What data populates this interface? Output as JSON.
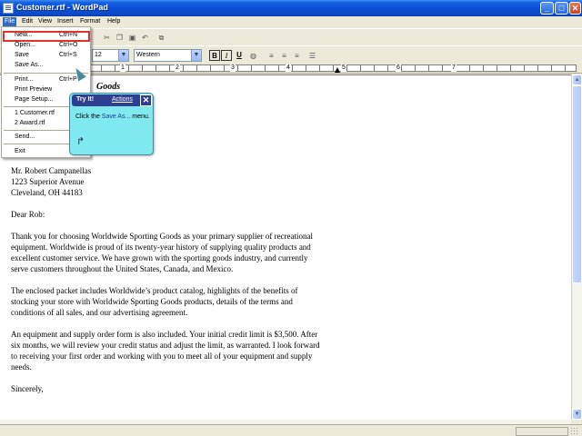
{
  "window": {
    "title": "Customer.rtf - WordPad",
    "controls": {
      "minimize": "_",
      "maximize": "□",
      "close": "✕"
    }
  },
  "menubar": {
    "file": "File",
    "edit": "Edit",
    "view": "View",
    "insert": "Insert",
    "format": "Format",
    "help": "Help"
  },
  "toolbar": {
    "font_size": "12",
    "script": "Western",
    "bold": "B",
    "italic": "I",
    "underline": "U"
  },
  "ruler": {
    "numbers": [
      "1",
      "2",
      "3",
      "4",
      "5",
      "6",
      "7"
    ]
  },
  "file_menu": {
    "items": [
      {
        "label": "New...",
        "shortcut": "Ctrl+N"
      },
      {
        "label": "Open...",
        "shortcut": "Ctrl+O"
      },
      {
        "label": "Save",
        "shortcut": "Ctrl+S"
      },
      {
        "label": "Save As...",
        "shortcut": ""
      },
      {
        "label": "Print...",
        "shortcut": "Ctrl+P"
      },
      {
        "label": "Print Preview",
        "shortcut": ""
      },
      {
        "label": "Page Setup...",
        "shortcut": ""
      },
      {
        "label": "1 Customer.rtf",
        "shortcut": ""
      },
      {
        "label": "2 Award.rtf",
        "shortcut": ""
      },
      {
        "label": "Send...",
        "shortcut": ""
      },
      {
        "label": "Exit",
        "shortcut": ""
      }
    ],
    "highlighted": "Save As..."
  },
  "tryit": {
    "title": "Try It!",
    "actions": "Actions",
    "close": "✕",
    "body_prefix": "Click the ",
    "body_highlight": "Save As...",
    "body_suffix": " menu."
  },
  "document": {
    "heading_fragment": "Goods",
    "lines": [
      "Mr. Robert Campanellas",
      "1223 Superior Avenue",
      "Cleveland, OH  44183",
      "",
      "Dear Rob:",
      "",
      "Thank you for choosing Worldwide Sporting Goods as your primary supplier of recreational",
      "equipment. Worldwide is proud of its twenty-year history of supplying quality products and",
      "excellent customer service. We have grown with the sporting goods industry, and currently",
      "serve customers throughout the United States, Canada, and Mexico.",
      "",
      "The enclosed packet includes Worldwide’s product catalog, highlights of the benefits of",
      "stocking your store with Worldwide Sporting Goods products, details of the terms and",
      "conditions of all sales, and our advertising agreement.",
      "",
      "An equipment and supply order form is also included. Your initial credit limit is $3,500. After",
      "six months, we will review your credit status and adjust the limit, as warranted. I look forward",
      "to receiving your first order and working with you to meet all of your equipment and supply",
      "needs.",
      "",
      "Sincerely,"
    ]
  }
}
